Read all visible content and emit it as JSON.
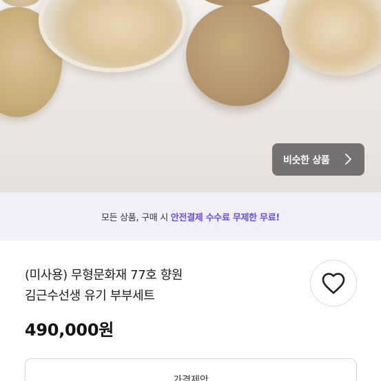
{
  "similar_button": {
    "label": "비슷한 상품",
    "icon": "chevron-right-icon"
  },
  "promo": {
    "text_prefix": "모든 상품, 구매 시 ",
    "highlight": "안전결제 수수료 무제한 무료!"
  },
  "product": {
    "title_line1": "(미사용) 무형문화재 77호 향원",
    "title_line2": "김근수선생 유기 부부세트",
    "price": "490,000원"
  },
  "favorite": {
    "icon": "heart-outline-icon"
  },
  "offer_button": {
    "label": "가격제안"
  },
  "colors": {
    "accent": "#6b4fd8",
    "promo_bg": "#f1f0fa",
    "button_overlay": "#464646"
  }
}
